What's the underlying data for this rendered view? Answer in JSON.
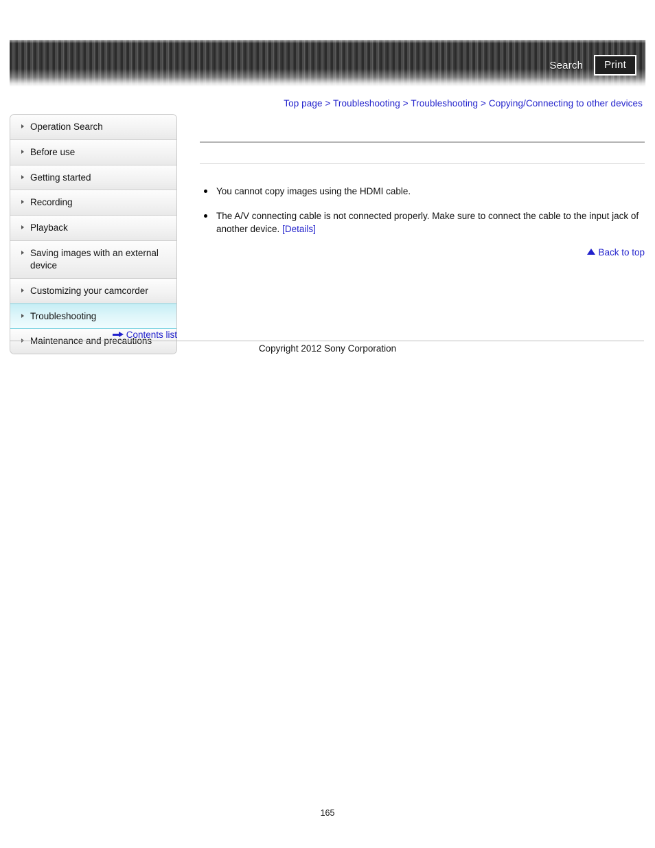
{
  "header": {
    "search_label": "Search",
    "print_label": "Print"
  },
  "breadcrumb": {
    "separator": ">",
    "items": [
      {
        "label": "Top page"
      },
      {
        "label": "Troubleshooting"
      },
      {
        "label": "Troubleshooting"
      },
      {
        "label": "Copying/Connecting to other devices"
      }
    ]
  },
  "sidebar": {
    "items": [
      {
        "label": "Operation Search",
        "active": false
      },
      {
        "label": "Before use",
        "active": false
      },
      {
        "label": "Getting started",
        "active": false
      },
      {
        "label": "Recording",
        "active": false
      },
      {
        "label": "Playback",
        "active": false
      },
      {
        "label": "Saving images with an external device",
        "active": false
      },
      {
        "label": "Customizing your camcorder",
        "active": false
      },
      {
        "label": "Troubleshooting",
        "active": true
      },
      {
        "label": "Maintenance and precautions",
        "active": false
      }
    ],
    "contents_list_label": "Contents list"
  },
  "content": {
    "title": "",
    "subtitle": "",
    "bullets": [
      {
        "text": "You cannot copy images using the HDMI cable.",
        "link": ""
      },
      {
        "text": "The A/V connecting cable is not connected properly. Make sure to connect the cable to the input jack of another device. ",
        "link": "[Details]"
      }
    ],
    "back_to_top_label": "Back to top"
  },
  "footer": {
    "copyright": "Copyright 2012 Sony Corporation",
    "page_number": "165"
  },
  "colors": {
    "link": "#2222cc",
    "active_nav": "#c6eef5",
    "header_dark": "#2c2c2c"
  }
}
